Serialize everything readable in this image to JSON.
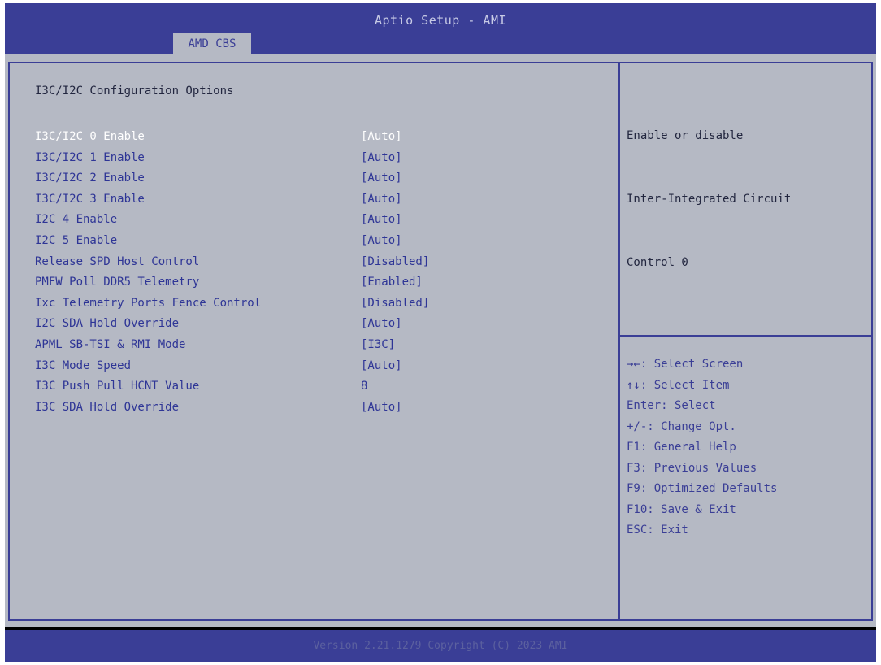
{
  "window": {
    "title": "Aptio Setup - AMI"
  },
  "tabs": [
    {
      "label": "AMD CBS",
      "active": true
    }
  ],
  "section_title": "I3C/I2C Configuration Options",
  "options": [
    {
      "label": "I3C/I2C 0 Enable",
      "value": "[Auto]",
      "selected": true
    },
    {
      "label": "I3C/I2C 1 Enable",
      "value": "[Auto]"
    },
    {
      "label": "I3C/I2C 2 Enable",
      "value": "[Auto]"
    },
    {
      "label": "I3C/I2C 3 Enable",
      "value": "[Auto]"
    },
    {
      "label": "I2C 4 Enable",
      "value": "[Auto]"
    },
    {
      "label": "I2C 5 Enable",
      "value": "[Auto]"
    },
    {
      "label": "Release SPD Host Control",
      "value": "[Disabled]"
    },
    {
      "label": "PMFW Poll DDR5 Telemetry",
      "value": "[Enabled]"
    },
    {
      "label": "Ixc Telemetry Ports Fence Control",
      "value": "[Disabled]"
    },
    {
      "label": "I2C SDA Hold Override",
      "value": "[Auto]"
    },
    {
      "label": "APML SB-TSI & RMI Mode",
      "value": "[I3C]"
    },
    {
      "label": "I3C Mode Speed",
      "value": "[Auto]"
    },
    {
      "label": "I3C Push Pull HCNT Value",
      "value": "8"
    },
    {
      "label": "I3C SDA Hold Override",
      "value": "[Auto]"
    }
  ],
  "help": {
    "lines": [
      "Enable or disable",
      "Inter-Integrated Circuit",
      "Control 0"
    ]
  },
  "keys": [
    "→←: Select Screen",
    "↑↓: Select Item",
    "Enter: Select",
    "+/-: Change Opt.",
    "F1: General Help",
    "F3: Previous Values",
    "F9: Optimized Defaults",
    "F10: Save & Exit",
    "ESC: Exit"
  ],
  "footer": {
    "version": "Version 2.21.1279 Copyright (C) 2023 AMI"
  },
  "colors": {
    "header_blue": "#3a3e96",
    "panel_gray": "#b5b9c4",
    "option_text": "#2e3596",
    "selected_text": "#ffffff"
  }
}
